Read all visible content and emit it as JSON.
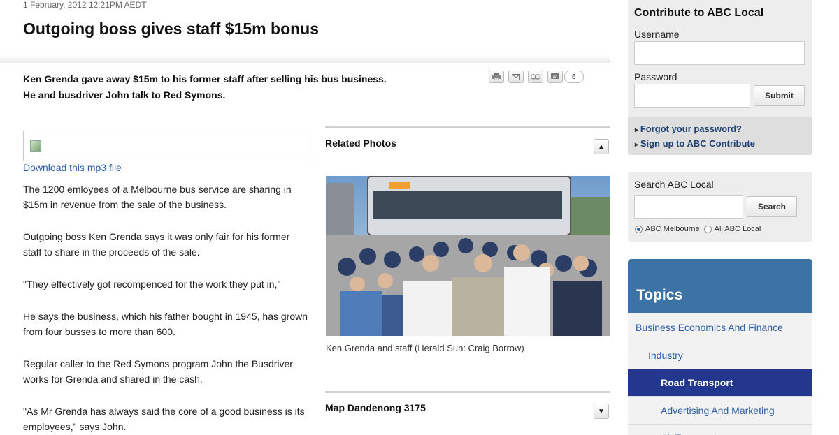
{
  "article": {
    "dateline": "1 February, 2012 12:21PM AEDT",
    "headline": "Outgoing boss gives staff $15m bonus",
    "summary_lines": [
      "Ken Grenda gave away $15m to his former staff after selling his bus business.",
      "He and busdriver John talk to Red Symons."
    ],
    "share_count": "6",
    "download_link": "Download this mp3 file",
    "paragraphs": [
      "The 1200 emloyees of a Melbourne bus service are sharing in $15m in revenue from the sale of the business.",
      "Outgoing boss Ken Grenda says it was only fair for his former staff to share in the proceeds of the sale.",
      "\"They effectively got recompenced for the work they put in,\"",
      "He says the business, which his father bought in 1945, has grown from four busses to more than 600.",
      "Regular caller to the Red Symons program John the Busdriver works for Grenda and shared in the cash.",
      "\"As Mr Grenda has always said the core of a good business is its employees,\" says John."
    ]
  },
  "related_photos": {
    "title": "Related Photos",
    "caption": "Ken Grenda and staff (Herald Sun: Craig Borrow)"
  },
  "map": {
    "title": "Map Dandenong 3175"
  },
  "contribute": {
    "title": "Contribute to ABC Local",
    "username_label": "Username",
    "password_label": "Password",
    "submit_label": "Submit",
    "forgot_link": "Forgot your password?",
    "signup_link": "Sign up to ABC Contribute"
  },
  "search": {
    "title": "Search ABC Local",
    "button_label": "Search",
    "options": [
      "ABC Melbourne",
      "All ABC Local"
    ],
    "selected": "ABC Melbourne"
  },
  "topics": {
    "title": "Topics",
    "items": [
      {
        "label": "Business Economics And Finance",
        "level": 0
      },
      {
        "label": "Industry",
        "level": 1
      },
      {
        "label": "Road Transport",
        "level": 2,
        "active": true
      },
      {
        "label": "Advertising And Marketing",
        "level": 2
      },
      {
        "label": "Air Transport",
        "level": 2
      }
    ]
  },
  "colors": {
    "link": "#2a60a8",
    "topics_header": "#3d72a4",
    "topic_active": "#23378f"
  }
}
